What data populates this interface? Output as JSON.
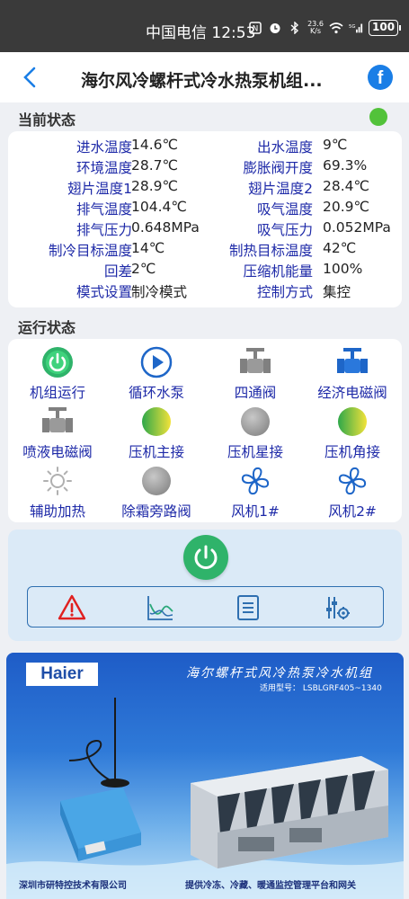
{
  "status_bar": {
    "time": "中国电信 12:53",
    "net_speed": "23.6 K/s",
    "battery": "100"
  },
  "header": {
    "title": "海尔风冷螺杆式冷水热泵机组..."
  },
  "current_status": {
    "title": "当前状态",
    "indicator_color": "#52c23a",
    "rows": [
      {
        "l1": "进水温度",
        "v1": "14.6℃",
        "l2": "出水温度",
        "v2": "9℃"
      },
      {
        "l1": "环境温度",
        "v1": "28.7℃",
        "l2": "膨胀阀开度",
        "v2": "69.3%"
      },
      {
        "l1": "翅片温度1",
        "v1": "28.9℃",
        "l2": "翅片温度2",
        "v2": "28.4℃"
      },
      {
        "l1": "排气温度",
        "v1": "104.4℃",
        "l2": "吸气温度",
        "v2": "20.9℃"
      },
      {
        "l1": "排气压力",
        "v1": "0.648MPa",
        "l2": "吸气压力",
        "v2": "0.052MPa"
      },
      {
        "l1": "制冷目标温度",
        "v1": "14℃",
        "l2": "制热目标温度",
        "v2": "42℃"
      },
      {
        "l1": "回差",
        "v1": "2℃",
        "l2": "压缩机能量",
        "v2": "100%"
      },
      {
        "l1": "模式设置",
        "v1": "制冷模式",
        "l2": "控制方式",
        "v2": "集控"
      }
    ]
  },
  "run_status": {
    "title": "运行状态",
    "items": [
      {
        "label": "机组运行",
        "icon": "power-icon"
      },
      {
        "label": "循环水泵",
        "icon": "play-icon"
      },
      {
        "label": "四通阀",
        "icon": "valve-icon"
      },
      {
        "label": "经济电磁阀",
        "icon": "valve-icon"
      },
      {
        "label": "喷液电磁阀",
        "icon": "valve-icon"
      },
      {
        "label": "压机主接",
        "icon": "indicator-icon"
      },
      {
        "label": "压机星接",
        "icon": "indicator-icon"
      },
      {
        "label": "压机角接",
        "icon": "indicator-icon"
      },
      {
        "label": "辅助加热",
        "icon": "sun-icon"
      },
      {
        "label": "除霜旁路阀",
        "icon": "indicator-icon"
      },
      {
        "label": "风机1#",
        "icon": "fan-icon"
      },
      {
        "label": "风机2#",
        "icon": "fan-icon"
      }
    ]
  },
  "banner": {
    "logo": "Haier",
    "title": "海尔螺杆式风冷热泵冷水机组",
    "model": "适用型号： LSBLGRF405~1340",
    "footer_left": "深圳市研特控技术有限公司",
    "footer_right": "提供冷冻、冷藏、暖通监控管理平台和网关"
  },
  "colors": {
    "label_blue": "#1e2aa8",
    "green": "#2fb36a",
    "accent_blue": "#1a7ee6"
  }
}
